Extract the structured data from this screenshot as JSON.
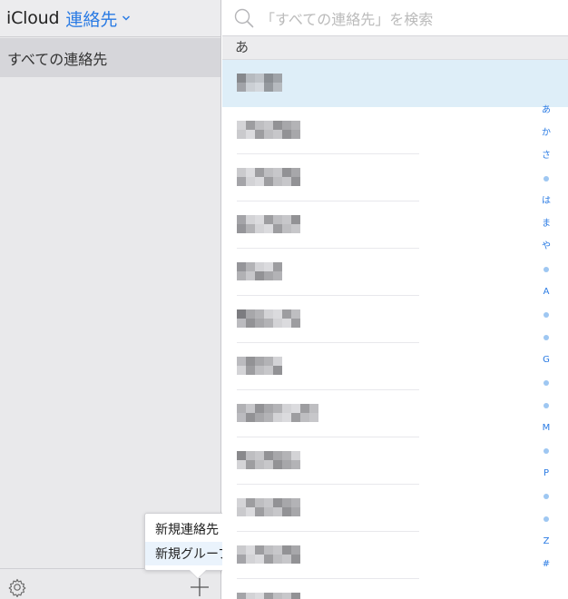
{
  "sidebar": {
    "brand": "iCloud",
    "app_title": "連絡先",
    "group_label": "すべての連絡先"
  },
  "popover": {
    "items": [
      {
        "label": "新規連絡先"
      },
      {
        "label": "新規グループ"
      }
    ]
  },
  "search": {
    "placeholder": "「すべての連絡先」を検索"
  },
  "list": {
    "section_label": "あ",
    "contact_count": 12
  },
  "index_bar": [
    {
      "label": "あ"
    },
    {
      "label": "か"
    },
    {
      "label": "さ"
    },
    {
      "label": "•"
    },
    {
      "label": "は"
    },
    {
      "label": "ま"
    },
    {
      "label": "や"
    },
    {
      "label": "•"
    },
    {
      "label": "A"
    },
    {
      "label": "•"
    },
    {
      "label": "•"
    },
    {
      "label": "G"
    },
    {
      "label": "•"
    },
    {
      "label": "•"
    },
    {
      "label": "M"
    },
    {
      "label": "•"
    },
    {
      "label": "P"
    },
    {
      "label": "•"
    },
    {
      "label": "•"
    },
    {
      "label": "Z"
    },
    {
      "label": "#"
    }
  ],
  "colors": {
    "accent": "#2a7be4",
    "sidebar_bg": "#e9e9eb",
    "selected_row": "#deeef8"
  },
  "icons": [
    "chevron-down-icon",
    "gear-icon",
    "plus-icon",
    "search-icon"
  ]
}
